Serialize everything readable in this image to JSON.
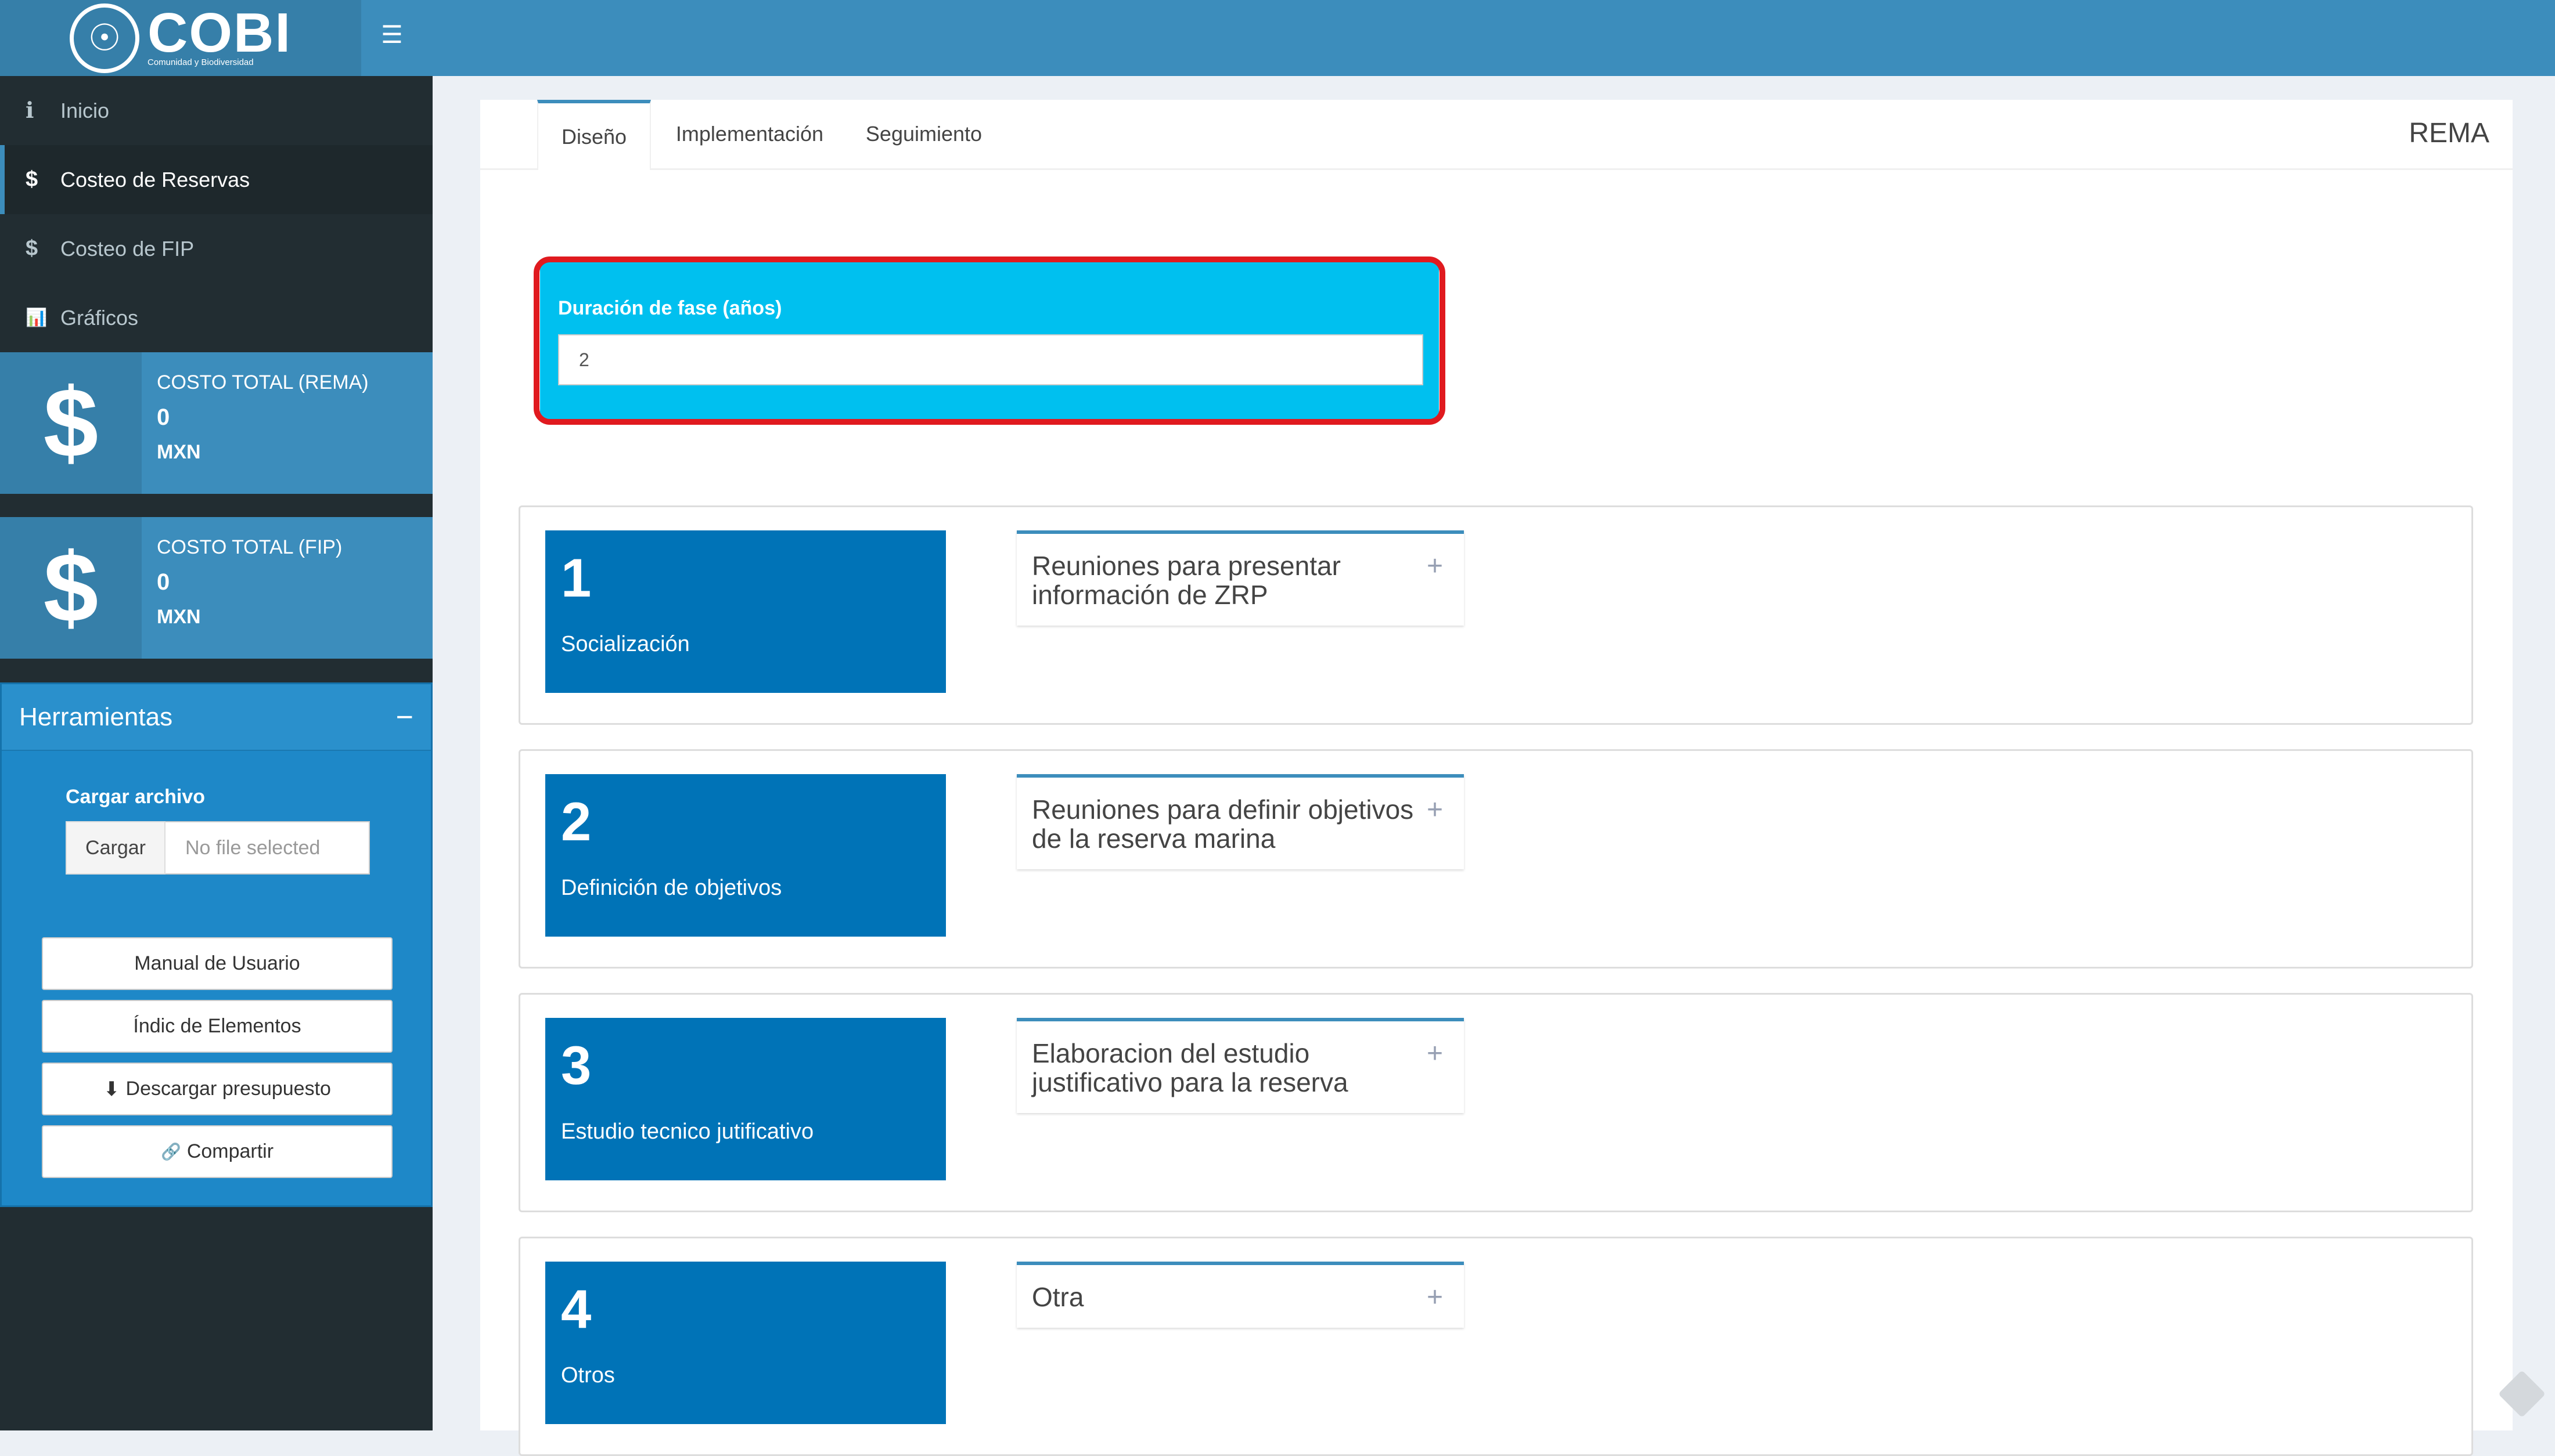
{
  "header": {
    "logo_text": "COBI",
    "logo_subtitle": "Comunidad y Biodiversidad"
  },
  "sidebar": {
    "items": [
      {
        "icon": "ℹ",
        "label": "Inicio"
      },
      {
        "icon": "$",
        "label": "Costeo de Reservas"
      },
      {
        "icon": "$",
        "label": "Costeo de FIP"
      },
      {
        "icon": "📊",
        "label": "Gráficos"
      }
    ],
    "info_boxes": [
      {
        "icon": "$",
        "title": "COSTO TOTAL (REMA)",
        "value": "0",
        "unit": "MXN"
      },
      {
        "icon": "$",
        "title": "COSTO TOTAL (FIP)",
        "value": "0",
        "unit": "MXN"
      }
    ],
    "tools": {
      "title": "Herramientas",
      "upload_label": "Cargar archivo",
      "upload_button": "Cargar",
      "upload_placeholder": "No file selected",
      "buttons": [
        {
          "icon": "",
          "label": "Manual de Usuario"
        },
        {
          "icon": "",
          "label": "Índic de Elementos"
        },
        {
          "icon": "⬇",
          "label": "Descargar presupuesto"
        },
        {
          "icon": "🔗",
          "label": "Compartir"
        }
      ]
    }
  },
  "main": {
    "tabs": [
      "Diseño",
      "Implementación",
      "Seguimiento"
    ],
    "active_tab": "Diseño",
    "section_title": "REMA",
    "phase": {
      "label": "Duración de fase (años)",
      "value": "2"
    },
    "steps": [
      {
        "number": "1",
        "name": "Socialización",
        "activity": "Reuniones para presentar información de ZRP"
      },
      {
        "number": "2",
        "name": "Definición de objetivos",
        "activity": "Reuniones para definir objetivos de la reserva marina"
      },
      {
        "number": "3",
        "name": "Estudio tecnico jutificativo",
        "activity": "Elaboracion del estudio justificativo para la reserva"
      },
      {
        "number": "4",
        "name": "Otros",
        "activity": "Otra"
      }
    ]
  },
  "colors": {
    "header_blue": "#3c8dbc",
    "sidebar_dark": "#222d32",
    "tile_blue": "#0073b7",
    "aqua": "#00c0ef",
    "highlight_red": "#e01a1f"
  }
}
